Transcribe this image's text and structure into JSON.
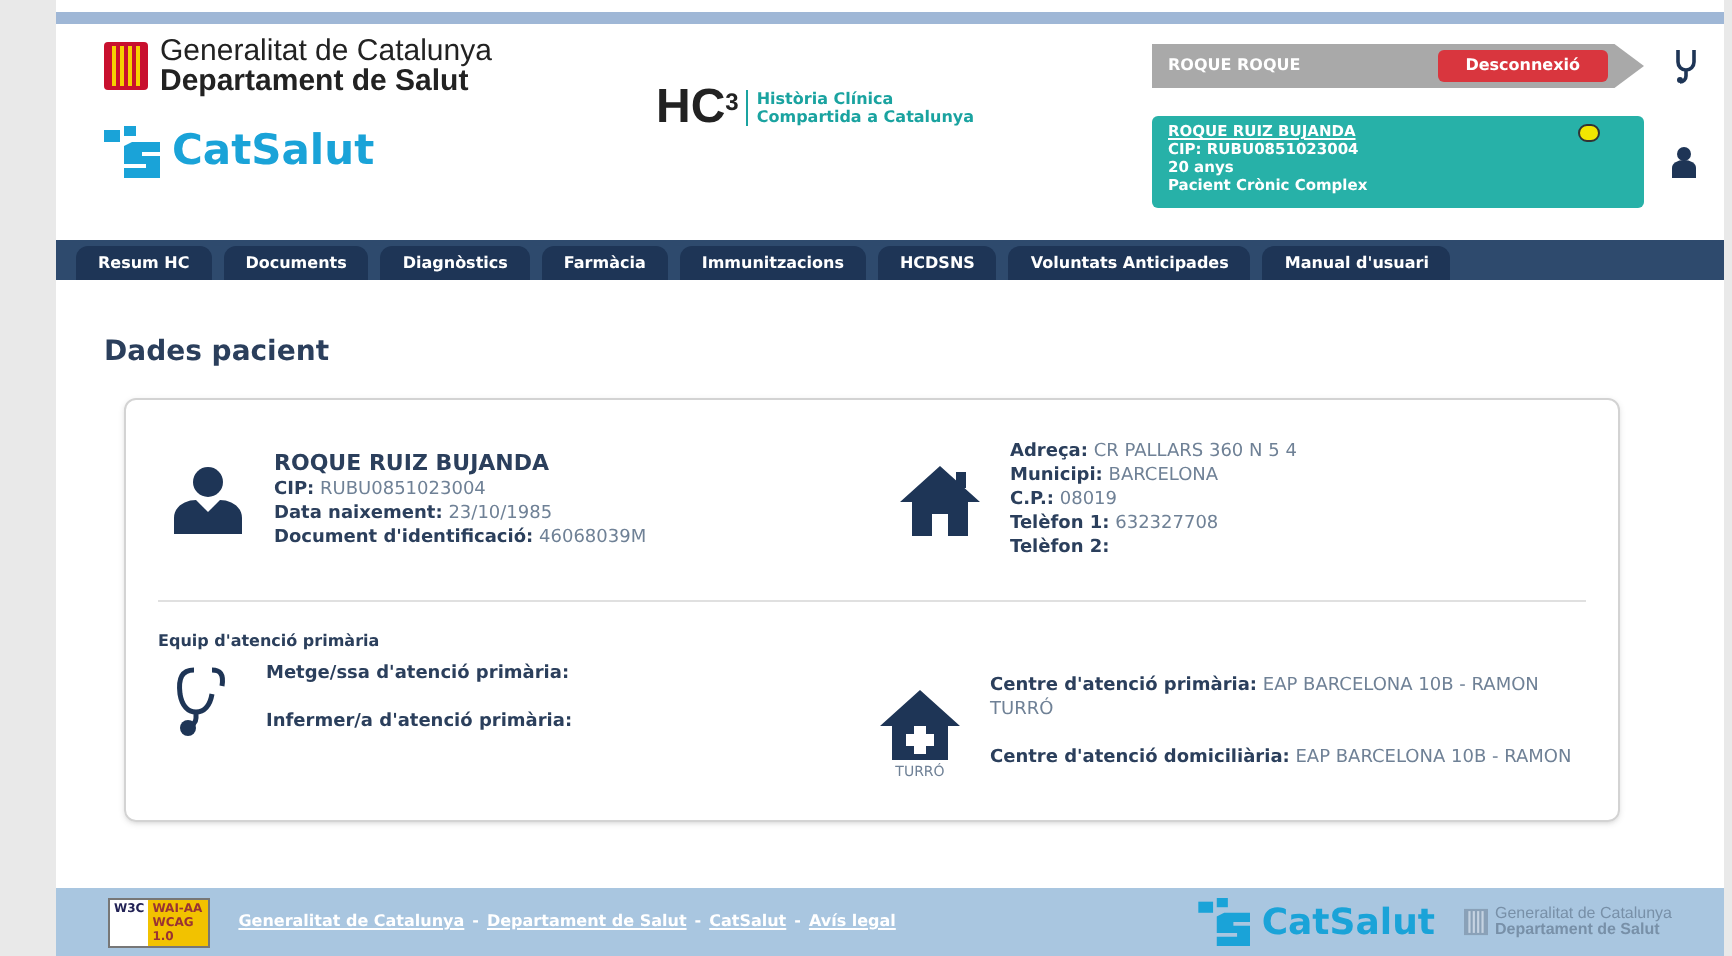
{
  "header": {
    "org_line1": "Generalitat de Catalunya",
    "org_line2": "Departament de Salut",
    "catsalut": "CatSalut",
    "hc3": "HC",
    "hc3_sup": "3",
    "hc3_sub1": "Història Clínica",
    "hc3_sub2": "Compartida a Catalunya",
    "user": "ROQUE ROQUE",
    "logout": "Desconnexió",
    "patient": {
      "name": "ROQUE RUIZ BUJANDA",
      "cip": "CIP: RUBU0851023004",
      "age": "20 anys",
      "tag": "Pacient Crònic Complex"
    }
  },
  "tabs": [
    {
      "label": "Resum HC"
    },
    {
      "label": "Documents"
    },
    {
      "label": "Diagnòstics"
    },
    {
      "label": "Farmàcia"
    },
    {
      "label": "Immunitzacions"
    },
    {
      "label": "HCDSNS"
    },
    {
      "label": "Voluntats Anticipades"
    },
    {
      "label": "Manual d'usuari"
    }
  ],
  "page_title": "Dades pacient",
  "patient": {
    "name": "ROQUE RUIZ BUJANDA",
    "fields": [
      {
        "label": "CIP:",
        "value": "RUBU0851023004"
      },
      {
        "label": "Data naixement:",
        "value": "23/10/1985"
      },
      {
        "label": "Document d'identificació:",
        "value": "46068039M"
      }
    ]
  },
  "address": {
    "fields": [
      {
        "label": "Adreça:",
        "value": "CR PALLARS 360 N 5 4"
      },
      {
        "label": "Municipi:",
        "value": "BARCELONA"
      },
      {
        "label": "C.P.:",
        "value": "08019"
      },
      {
        "label": "Telèfon 1:",
        "value": "632327708"
      },
      {
        "label": "Telèfon 2:"
      }
    ]
  },
  "team": {
    "title": "Equip d'atenció primària",
    "fields": [
      {
        "label": "Metge/ssa d'atenció primària:"
      },
      {
        "label": "Infermer/a d'atenció primària:"
      }
    ]
  },
  "centre": {
    "icon_caption": "TURRÓ",
    "fields": [
      {
        "label": "Centre d'atenció primària:",
        "value": "EAP BARCELONA 10B - RAMON TURRÓ"
      },
      {
        "label": "Centre d'atenció domiciliària:",
        "value": "EAP BARCELONA 10B - RAMON"
      }
    ]
  },
  "footer": {
    "badge_left": "W3C",
    "badge_right": "WAI-AA WCAG 1.0",
    "links": [
      "Generalitat de Catalunya",
      "Departament de Salut",
      "CatSalut",
      "Avís legal"
    ],
    "separator": "-",
    "catsalut": "CatSalut",
    "org_line1": "Generalitat de Catalunya",
    "org_line2": "Departament de Salut"
  }
}
